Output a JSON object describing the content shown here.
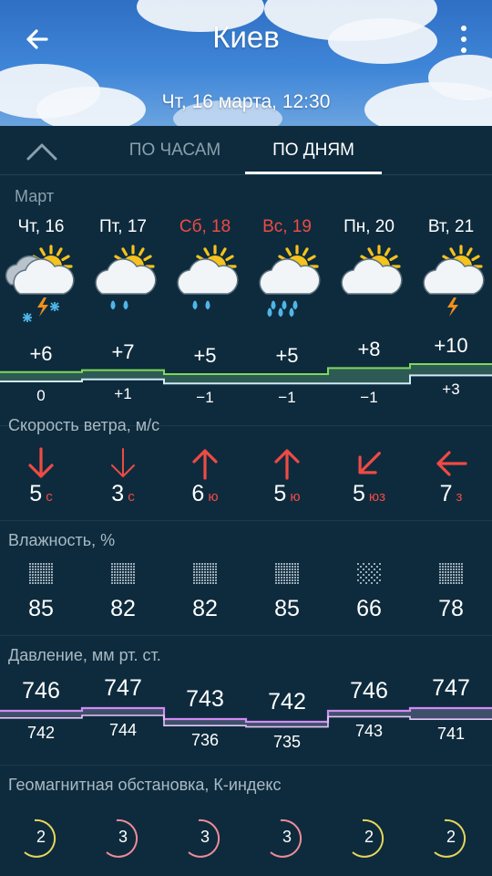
{
  "header": {
    "city": "Киев",
    "date": "Чт, 16 марта, 12:30",
    "back_icon": "arrow-left-icon",
    "menu_icon": "more-vert-icon"
  },
  "tabs": {
    "collapse_icon": "chevron-up-icon",
    "hours": "ПО ЧАСАМ",
    "days": "ПО ДНЯМ",
    "active": "days"
  },
  "month": "Март",
  "days": [
    {
      "label": "Чт, 16",
      "weekend": false,
      "icon": "partly-cloudy-thunder-snow-icon",
      "t_max": "+6",
      "t_min": "0",
      "wind_speed": "5",
      "wind_dir": "с",
      "humidity": "85",
      "p_max": "746",
      "p_min": "742",
      "k_index": "2"
    },
    {
      "label": "Пт, 17",
      "weekend": false,
      "icon": "partly-cloudy-rain-icon",
      "t_max": "+7",
      "t_min": "+1",
      "wind_speed": "3",
      "wind_dir": "с",
      "humidity": "82",
      "p_max": "747",
      "p_min": "744",
      "k_index": "3"
    },
    {
      "label": "Сб, 18",
      "weekend": true,
      "icon": "partly-cloudy-rain-icon",
      "t_max": "+5",
      "t_min": "−1",
      "wind_speed": "6",
      "wind_dir": "ю",
      "humidity": "82",
      "p_max": "743",
      "p_min": "736",
      "k_index": "3"
    },
    {
      "label": "Вс, 19",
      "weekend": true,
      "icon": "partly-cloudy-heavy-rain-icon",
      "t_max": "+5",
      "t_min": "−1",
      "wind_speed": "5",
      "wind_dir": "ю",
      "humidity": "85",
      "p_max": "742",
      "p_min": "735",
      "k_index": "3"
    },
    {
      "label": "Пн, 20",
      "weekend": false,
      "icon": "partly-cloudy-icon",
      "t_max": "+8",
      "t_min": "−1",
      "wind_speed": "5",
      "wind_dir": "юз",
      "humidity": "66",
      "p_max": "746",
      "p_min": "743",
      "k_index": "2"
    },
    {
      "label": "Вт, 21",
      "weekend": false,
      "icon": "partly-cloudy-thunder-icon",
      "t_max": "+10",
      "t_min": "+3",
      "wind_speed": "7",
      "wind_dir": "з",
      "humidity": "78",
      "p_max": "747",
      "p_min": "741",
      "k_index": "2"
    }
  ],
  "sections": {
    "wind": "Скорость ветра, м/с",
    "humidity": "Влажность, %",
    "pressure": "Давление, мм рт. ст.",
    "geomagnetic": "Геомагнитная обстановка, К-индекс"
  },
  "colors": {
    "background": "#0e2b3d",
    "temp_band": "#7ed957",
    "temp_band_low": "#cfe9f5",
    "pressure_band": "#d08cf2",
    "weekend": "#ef4a45",
    "k_low": "#e8d65a",
    "k_mid": "#f08c9a"
  }
}
